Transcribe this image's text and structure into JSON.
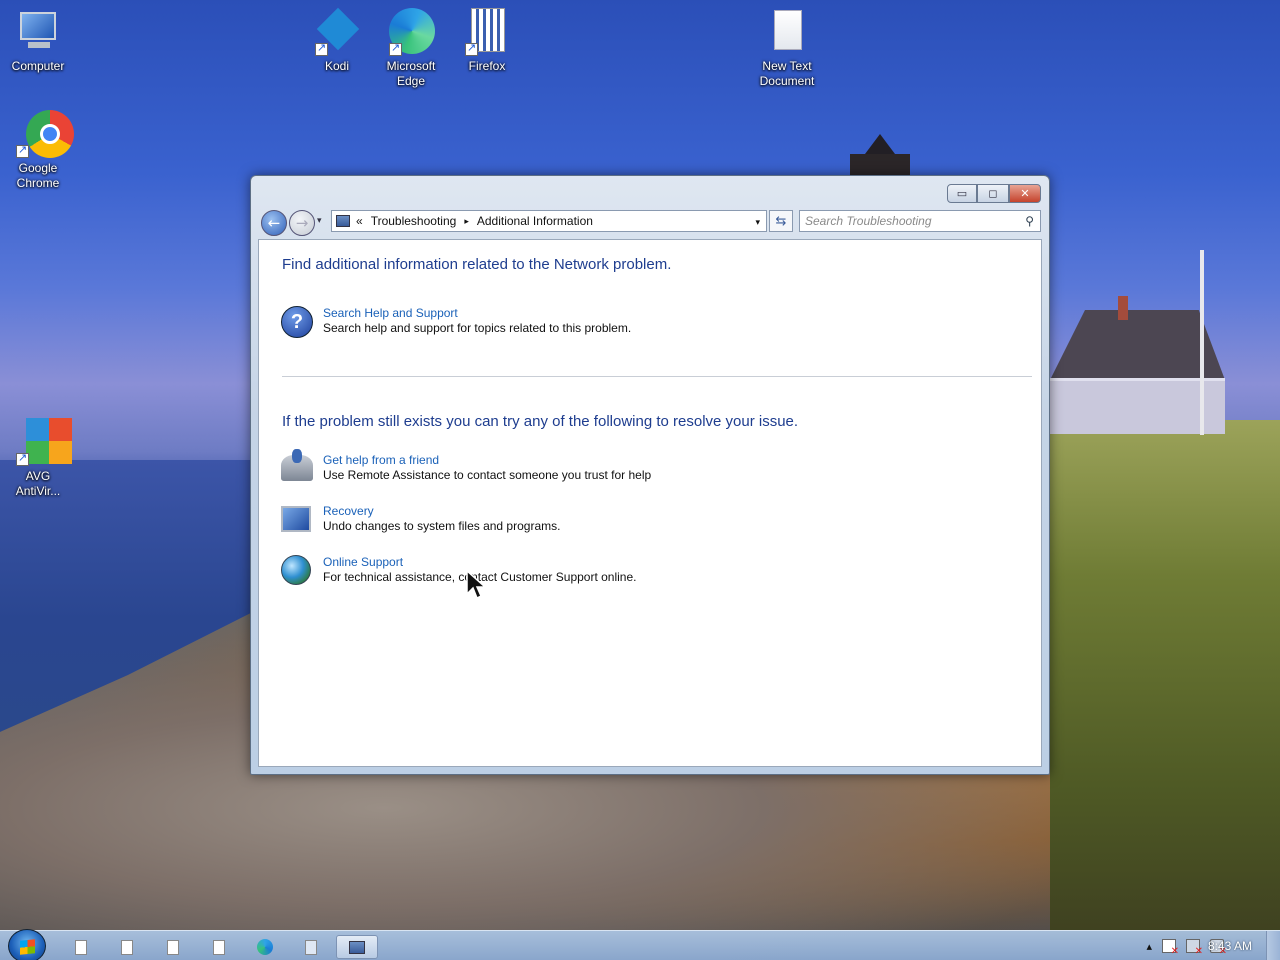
{
  "desktop": {
    "icons": [
      {
        "label_line1": "Computer",
        "label_line2": ""
      },
      {
        "label_line1": "Kodi",
        "label_line2": ""
      },
      {
        "label_line1": "Microsoft",
        "label_line2": "Edge"
      },
      {
        "label_line1": "Firefox",
        "label_line2": ""
      },
      {
        "label_line1": "New Text",
        "label_line2": "Document"
      },
      {
        "label_line1": "Google",
        "label_line2": "Chrome"
      },
      {
        "label_line1": "AVG",
        "label_line2": "AntiVir..."
      }
    ]
  },
  "window": {
    "buttons": {
      "minimize": "▭",
      "maximize": "◻",
      "close": "✕"
    },
    "nav": {
      "back_icon": "back-arrow-icon",
      "forward_icon": "forward-arrow-icon",
      "history_glyph": "▾",
      "breadcrumb_prefix": "«",
      "breadcrumb": [
        "Troubleshooting",
        "Additional Information"
      ],
      "breadcrumb_sep": "▸",
      "dropdown_glyph": "▾",
      "refresh_glyph": "⇆"
    },
    "search": {
      "placeholder": "Search Troubleshooting",
      "icon": "⚲"
    },
    "content": {
      "heading1": "Find additional information related to the Network problem.",
      "item_help": {
        "link": "Search Help and Support",
        "desc": "Search help and support for topics related to this problem."
      },
      "heading2": "If the problem still exists you can try any of the following to resolve your issue.",
      "item_friend": {
        "link": "Get help from a friend",
        "desc": "Use Remote Assistance to contact someone you trust for help"
      },
      "item_recovery": {
        "link": "Recovery",
        "desc": "Undo changes to system files and programs."
      },
      "item_online": {
        "link": "Online Support",
        "desc": "For technical assistance, contact Customer Support online."
      }
    }
  },
  "taskbar": {
    "clock": "8:43 AM",
    "tray_glyph": "▴"
  },
  "colors": {
    "link": "#1a61b8",
    "heading": "#1e3d8f",
    "close_button": "#c5432c"
  }
}
